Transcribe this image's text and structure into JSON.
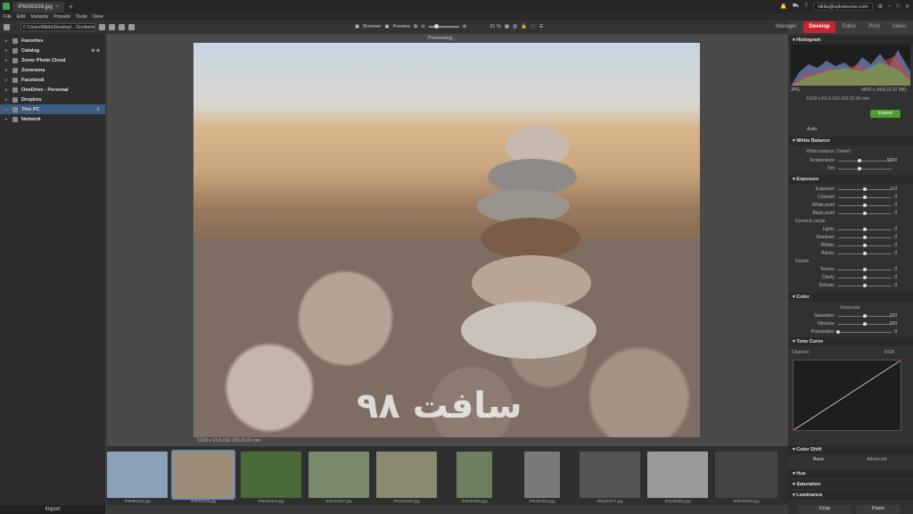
{
  "window": {
    "tab_title": "IP6090339.jpg",
    "account": "nikita@zphotocine.com"
  },
  "menu": [
    "File",
    "Edit",
    "Variants",
    "Presets",
    "Tools",
    "View"
  ],
  "modes": [
    {
      "label": "Manager",
      "active": false
    },
    {
      "label": "Develop",
      "active": true
    },
    {
      "label": "Editor",
      "active": false
    },
    {
      "label": "Print",
      "active": false
    },
    {
      "label": "Video",
      "active": false
    }
  ],
  "toolbar": {
    "path": "C:\\Users\\Nikita\\Desktop\\...\\Scotland",
    "browser": "Browser",
    "preview": "Preview",
    "zoom": "31 %",
    "processing": "Processing..."
  },
  "sidebar": [
    {
      "label": "Favorites",
      "arrow": "▸"
    },
    {
      "label": "Catalog",
      "arrow": "▸",
      "suffix": "⊕ ⊗"
    },
    {
      "label": "Zoner Photo Cloud",
      "arrow": "▸"
    },
    {
      "label": "Zonerama",
      "arrow": "▸"
    },
    {
      "label": "Facebook",
      "arrow": "▸"
    },
    {
      "label": "OneDrive - Personal",
      "arrow": "▸"
    },
    {
      "label": "Dropbox",
      "arrow": "▸"
    },
    {
      "label": "This PC",
      "arrow": "▸",
      "selected": true,
      "suffix": "⇕"
    },
    {
      "label": "Network",
      "arrow": "▸"
    }
  ],
  "import_label": "Import",
  "photo_info": "1/200 s  F5.6  ISO 200  33.00 mm",
  "filmstrip": [
    {
      "name": "IP6090318.jpg",
      "color": "#8aa0b8"
    },
    {
      "name": "IP6090339.jpg",
      "color": "#9e8c7a",
      "selected": true
    },
    {
      "name": "IP6090343.jpg",
      "color": "#4a6a38"
    },
    {
      "name": "IP6100337.jpg",
      "color": "#7a8a6c"
    },
    {
      "name": "IP6100382.jpg",
      "color": "#8a8a70"
    },
    {
      "name": "IP6100383.jpg",
      "color": "#6c8060"
    },
    {
      "name": "IP6100384.jpg",
      "color": "#7a7a7a"
    },
    {
      "name": "IP6100377.jpg",
      "color": "#555"
    },
    {
      "name": "IP6100391.jpg",
      "color": "#9a9a9a"
    },
    {
      "name": "IP6100393.jpg",
      "color": "#444"
    }
  ],
  "right": {
    "histogram": "Histogram",
    "file_type": "JPG",
    "file_dims": "4899 x 3456 (8.32 MB)",
    "exif": "1/200 s   F5.6   ISO 200   33.00 mm",
    "export": "Export",
    "auto": "Auto",
    "white_balance": {
      "title": "White Balance",
      "mode_label": "White balance",
      "mode_value": "Default",
      "rows": [
        {
          "label": "Temperature",
          "value": "5600",
          "pos": 0.4
        },
        {
          "label": "Tint",
          "value": "",
          "pos": 0.4
        }
      ]
    },
    "exposure": {
      "title": "Exposure",
      "rows": [
        {
          "label": "Exposure",
          "value": "0.0",
          "pos": 0.5
        },
        {
          "label": "Contrast",
          "value": "0",
          "pos": 0.5
        },
        {
          "label": "White point",
          "value": "0",
          "pos": 0.5
        },
        {
          "label": "Black point",
          "value": "0",
          "pos": 0.5
        }
      ],
      "dynamic_range": "Dynamic range",
      "dr_rows": [
        {
          "label": "Lights",
          "value": "0",
          "pos": 0.5
        },
        {
          "label": "Shadows",
          "value": "0",
          "pos": 0.5
        },
        {
          "label": "Whites",
          "value": "0",
          "pos": 0.5
        },
        {
          "label": "Blacks",
          "value": "0",
          "pos": 0.5
        }
      ],
      "details": "Details",
      "det_rows": [
        {
          "label": "Texture",
          "value": "0",
          "pos": 0.5
        },
        {
          "label": "Clarity",
          "value": "0",
          "pos": 0.5
        },
        {
          "label": "Dehaze",
          "value": "0",
          "pos": 0.5
        }
      ]
    },
    "color": {
      "title": "Color",
      "grayscale": "Grayscale",
      "rows": [
        {
          "label": "Saturation",
          "value": "100",
          "pos": 0.5
        },
        {
          "label": "Vibrance",
          "value": "100",
          "pos": 0.5
        },
        {
          "label": "Polarization",
          "value": "0",
          "pos": 0.0
        }
      ]
    },
    "tone_curve": {
      "title": "Tone Curve",
      "channel": "Channel:",
      "preset": "RGB"
    },
    "color_shift": {
      "title": "Color Shift",
      "basic": "Basic",
      "advanced": "Advanced"
    },
    "hue": "Hue",
    "saturation": "Saturation",
    "luminance": "Luminance",
    "copy": "Copy",
    "paste": "Paste"
  }
}
